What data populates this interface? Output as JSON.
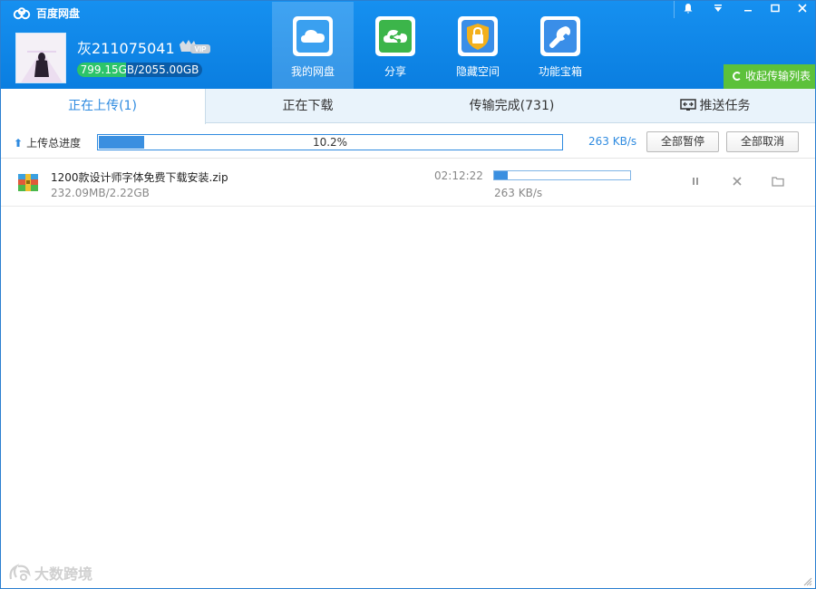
{
  "app": {
    "title": "百度网盘"
  },
  "user": {
    "name": "灰211075041",
    "vip_label": "VIP",
    "quota_text": "799.15GB/2055.00GB",
    "quota_fraction": 0.389
  },
  "nav": [
    {
      "label": "我的网盘",
      "icon": "cloud-icon",
      "color": "#3aa0f0"
    },
    {
      "label": "分享",
      "icon": "share-icon",
      "color": "#3cb54a"
    },
    {
      "label": "隐藏空间",
      "icon": "lock-icon",
      "color": "#f3b01c"
    },
    {
      "label": "功能宝箱",
      "icon": "wrench-icon",
      "color": "#3a8ee8"
    }
  ],
  "window_controls": {
    "bell": "bell-icon",
    "menu": "menu-icon",
    "minimize": "minimize-icon",
    "maximize": "maximize-icon",
    "close": "close-icon"
  },
  "collapse_label": "收起传输列表",
  "tabs": [
    {
      "label": "正在上传(1)"
    },
    {
      "label": "正在下载"
    },
    {
      "label": "传输完成(731)"
    },
    {
      "label": "推送任务"
    }
  ],
  "total": {
    "label": "上传总进度",
    "percent_text": "10.2%",
    "percent": 0.102,
    "speed": "263 KB/s",
    "pause_all": "全部暂停",
    "cancel_all": "全部取消"
  },
  "task": {
    "name": "1200款设计师字体免费下载安装.zip",
    "size": "232.09MB/2.22GB",
    "time_left": "02:12:22",
    "progress": 0.102,
    "speed": "263 KB/s"
  },
  "watermark": "大数跨境",
  "colors": {
    "header": "#0f83e8",
    "accent": "#2f8be0",
    "green": "#5cc13a"
  }
}
